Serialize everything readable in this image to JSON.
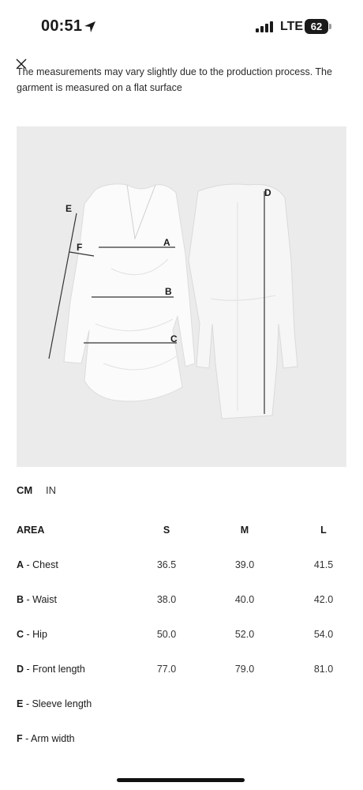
{
  "status": {
    "time": "00:51",
    "network": "LTE",
    "battery": "62"
  },
  "note": "The measurements may vary slightly due to the production process. The garment is measured on a flat surface",
  "image": {
    "labels": {
      "a": "A",
      "b": "B",
      "c": "C",
      "d": "D",
      "e": "E",
      "f": "F"
    }
  },
  "units": {
    "cm": "CM",
    "in": "IN",
    "selected": "CM"
  },
  "table": {
    "header": {
      "area": "AREA",
      "s": "S",
      "m": "M",
      "l": "L"
    },
    "rows": [
      {
        "code": "A",
        "name": " - Chest",
        "s": "36.5",
        "m": "39.0",
        "l": "41.5"
      },
      {
        "code": "B",
        "name": " - Waist",
        "s": "38.0",
        "m": "40.0",
        "l": "42.0"
      },
      {
        "code": "C",
        "name": " - Hip",
        "s": "50.0",
        "m": "52.0",
        "l": "54.0"
      },
      {
        "code": "D",
        "name": " - Front length",
        "s": "77.0",
        "m": "79.0",
        "l": "81.0"
      },
      {
        "code": "E",
        "name": " - Sleeve length",
        "s": "",
        "m": "",
        "l": ""
      },
      {
        "code": "F",
        "name": " - Arm width",
        "s": "",
        "m": "",
        "l": ""
      }
    ]
  }
}
